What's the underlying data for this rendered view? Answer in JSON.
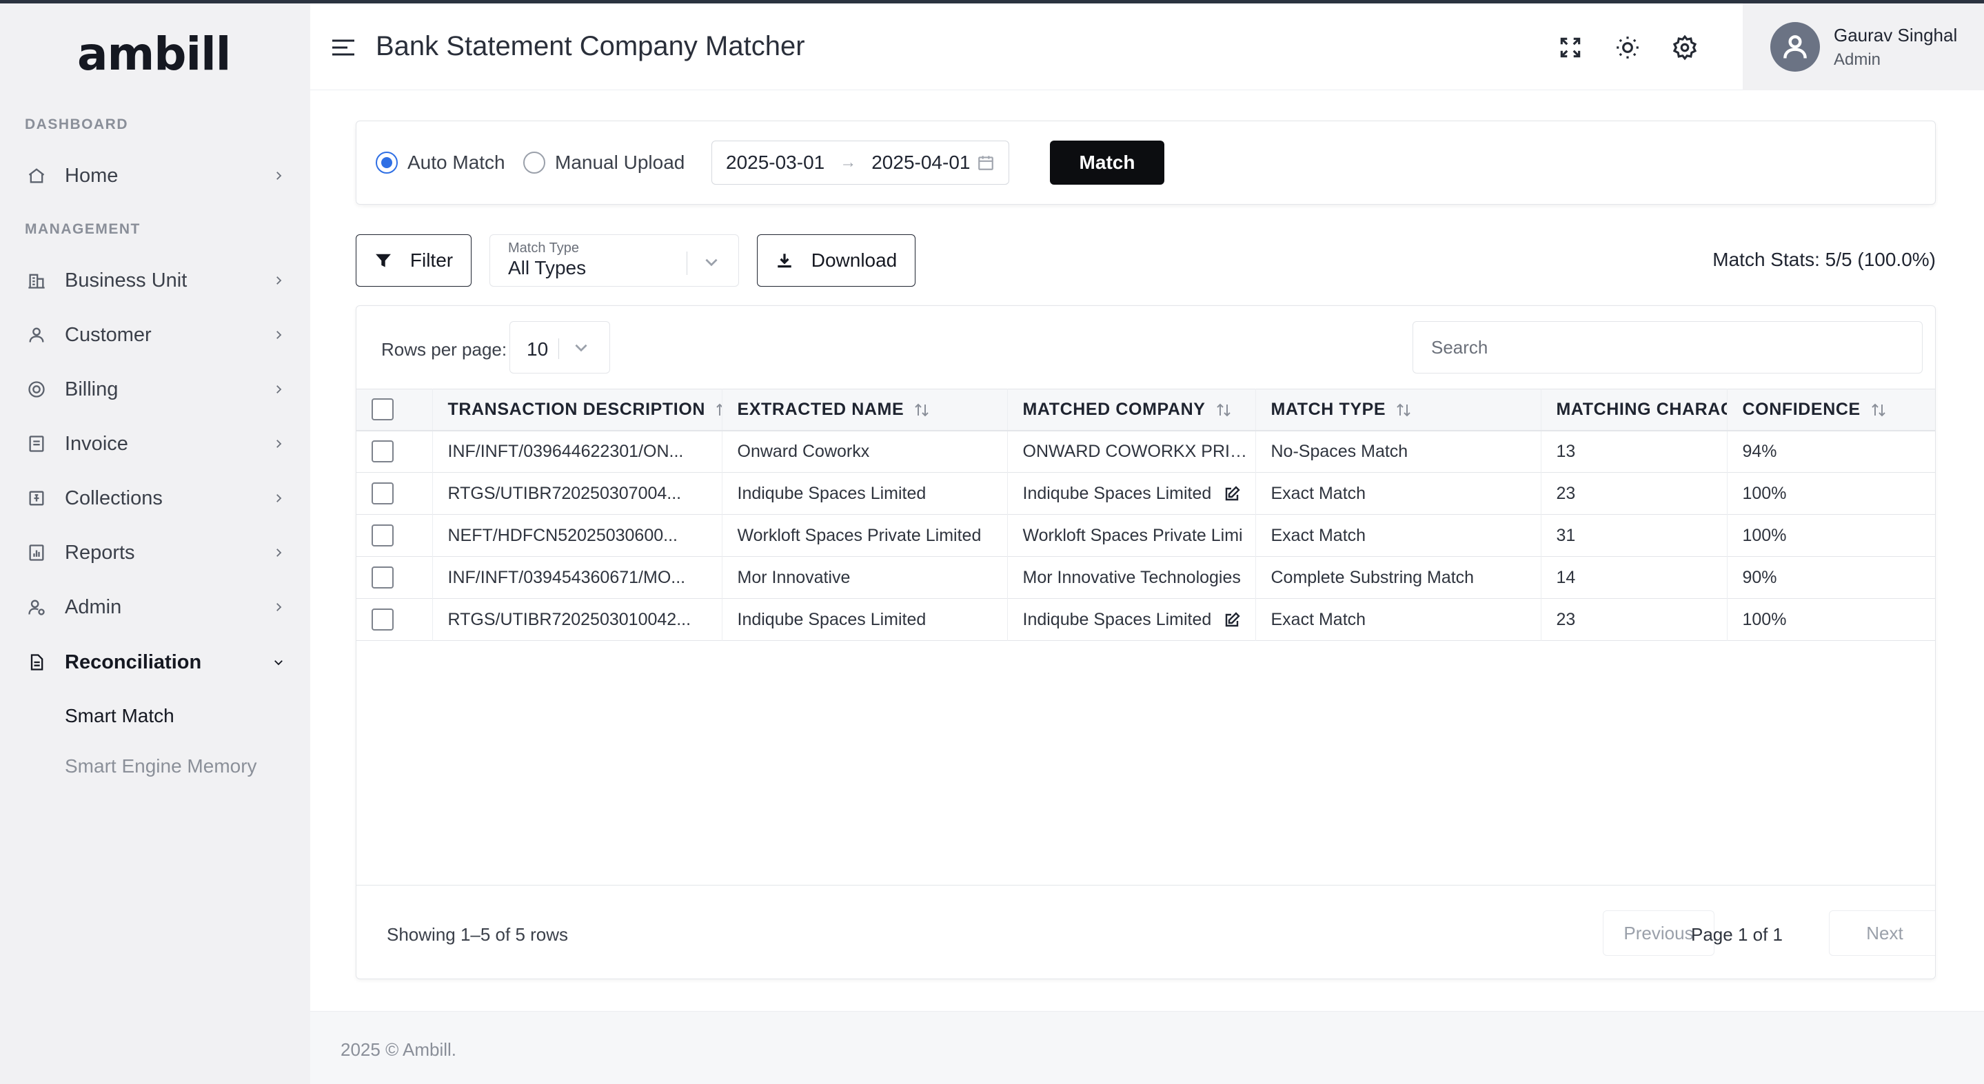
{
  "app": {
    "logo_text": "ambill"
  },
  "sidebar": {
    "section_dashboard": "DASHBOARD",
    "section_management": "MANAGEMENT",
    "items": [
      {
        "label": "Home",
        "icon": "home-icon"
      },
      {
        "label": "Business Unit",
        "icon": "building-icon"
      },
      {
        "label": "Customer",
        "icon": "user-icon"
      },
      {
        "label": "Billing",
        "icon": "billing-icon"
      },
      {
        "label": "Invoice",
        "icon": "invoice-icon"
      },
      {
        "label": "Collections",
        "icon": "collections-icon"
      },
      {
        "label": "Reports",
        "icon": "reports-icon"
      },
      {
        "label": "Admin",
        "icon": "admin-icon"
      },
      {
        "label": "Reconciliation",
        "icon": "reconciliation-icon"
      }
    ],
    "sub_items": [
      {
        "label": "Smart Match"
      },
      {
        "label": "Smart Engine Memory"
      }
    ]
  },
  "header": {
    "title": "Bank Statement Company Matcher",
    "user": {
      "name": "Gaurav Singhal",
      "role": "Admin"
    }
  },
  "controls": {
    "auto_match_label": "Auto Match",
    "manual_upload_label": "Manual Upload",
    "date_start": "2025-03-01",
    "date_end": "2025-04-01",
    "match_button": "Match",
    "filter_button": "Filter",
    "match_type_label": "Match Type",
    "match_type_value": "All Types",
    "download_button": "Download",
    "match_stats": "Match Stats: 5/5 (100.0%)"
  },
  "table": {
    "rows_per_page_label": "Rows per page:",
    "rows_per_page_value": "10",
    "search_placeholder": "Search",
    "columns": [
      "TRANSACTION DESCRIPTION",
      "EXTRACTED NAME",
      "MATCHED COMPANY",
      "MATCH TYPE",
      "MATCHING CHARAC",
      "CONFIDENCE"
    ],
    "rows": [
      {
        "description": "INF/INFT/039644622301/ON...",
        "extracted": "Onward Coworkx",
        "company": "ONWARD COWORKX PRIVAT",
        "match_type": "No-Spaces Match",
        "chars": "13",
        "confidence": "94%"
      },
      {
        "description": "RTGS/UTIBR720250307004...",
        "extracted": "Indiqube Spaces Limited",
        "company": "Indiqube Spaces Limited",
        "match_type": "Exact Match",
        "chars": "23",
        "confidence": "100%"
      },
      {
        "description": "NEFT/HDFCN52025030600...",
        "extracted": "Workloft Spaces Private Limited",
        "company": "Workloft Spaces Private Limi",
        "match_type": "Exact Match",
        "chars": "31",
        "confidence": "100%"
      },
      {
        "description": "INF/INFT/039454360671/MO...",
        "extracted": "Mor Innovative",
        "company": "Mor Innovative Technologies",
        "match_type": "Complete Substring Match",
        "chars": "14",
        "confidence": "90%"
      },
      {
        "description": "RTGS/UTIBR7202503010042...",
        "extracted": "Indiqube Spaces Limited",
        "company": "Indiqube Spaces Limited",
        "match_type": "Exact Match",
        "chars": "23",
        "confidence": "100%"
      }
    ],
    "showing": "Showing 1–5 of 5 rows",
    "prev_label": "Previous",
    "page_info": "Page 1 of 1",
    "next_label": "Next"
  },
  "footer": {
    "copyright": "2025 © Ambill."
  },
  "colors": {
    "accent": "#2f6fe4",
    "primary_button": "#0c0d10",
    "sidebar_bg": "#f1f1f3"
  }
}
